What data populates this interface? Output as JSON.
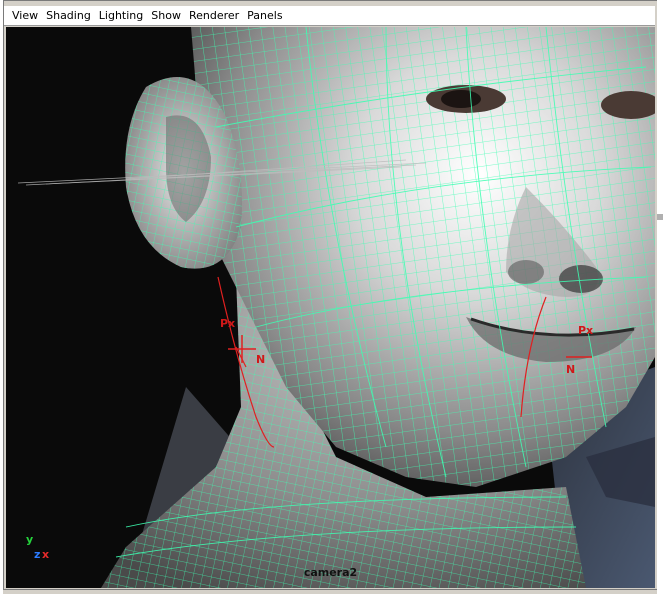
{
  "menubar": {
    "items": [
      "View",
      "Shading",
      "Lighting",
      "Show",
      "Renderer",
      "Panels"
    ]
  },
  "viewport": {
    "camera_name": "camera2",
    "axis_labels": {
      "y": "y",
      "z": "z",
      "x": "x"
    },
    "annotations": {
      "left_px": "Px",
      "left_n": "N",
      "right_px": "Px",
      "right_n": "N"
    },
    "colors": {
      "wireframe": "#3dffb2",
      "curve": "#e02020",
      "background": "#000000"
    },
    "icons": [
      "axis-gizmo-icon"
    ]
  }
}
